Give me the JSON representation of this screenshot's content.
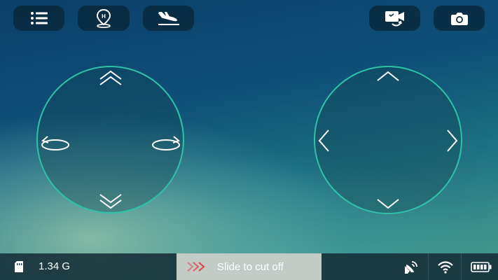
{
  "toolbar": {
    "menu_icon": "menu-icon",
    "home_icon": "home-point-icon",
    "landing_icon": "landing-plane-icon",
    "video_switch_icon": "video-switch-icon",
    "camera_icon": "camera-icon"
  },
  "left_joystick": {
    "up_icon": "double-chevron-up-icon",
    "down_icon": "double-chevron-down-icon",
    "rotate_left_icon": "rotate-left-icon",
    "rotate_right_icon": "rotate-right-icon"
  },
  "right_joystick": {
    "up_icon": "chevron-up-icon",
    "down_icon": "chevron-down-icon",
    "left_icon": "chevron-left-icon",
    "right_icon": "chevron-right-icon"
  },
  "bottom_bar": {
    "storage_value": "1.34 G",
    "slider_label": "Slide to cut off",
    "icons": [
      "sd-card-icon",
      "satellite-icon",
      "wifi-icon",
      "battery-icon"
    ]
  },
  "colors": {
    "accent": "#2ec2a8",
    "slider_chevron": "#e0404a",
    "button_bg": "#08283a"
  }
}
